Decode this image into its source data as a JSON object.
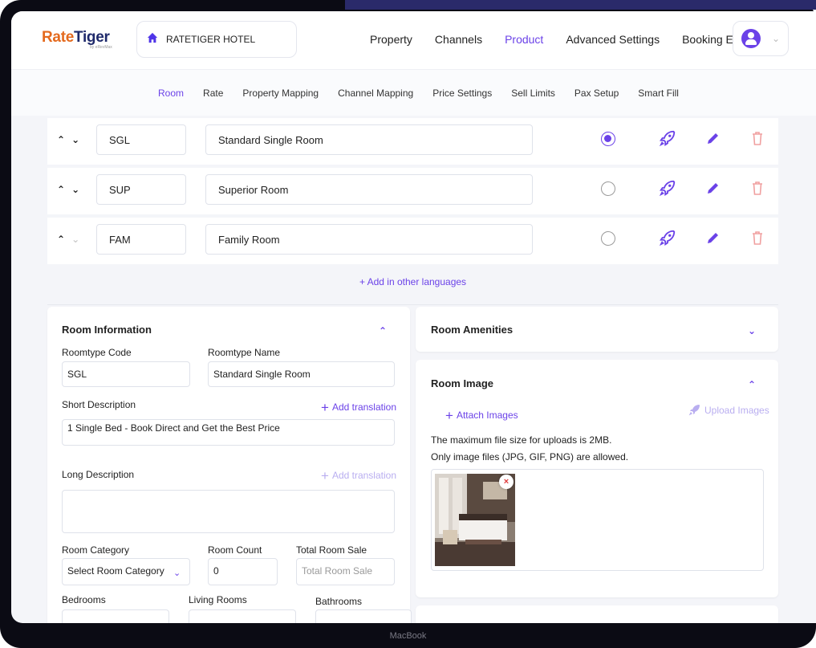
{
  "brand": {
    "name_first": "Rate",
    "name_second": "Tiger",
    "sub": "by eRevMax"
  },
  "hotel_selector": {
    "label": "RATETIGER HOTEL"
  },
  "top_nav": [
    {
      "label": "Property",
      "active": false
    },
    {
      "label": "Channels",
      "active": false
    },
    {
      "label": "Product",
      "active": true
    },
    {
      "label": "Advanced Settings",
      "active": false
    },
    {
      "label": "Booking Engine",
      "active": false
    }
  ],
  "sub_nav": [
    {
      "label": "Room",
      "active": true
    },
    {
      "label": "Rate",
      "active": false
    },
    {
      "label": "Property Mapping",
      "active": false
    },
    {
      "label": "Channel Mapping",
      "active": false
    },
    {
      "label": "Price Settings",
      "active": false
    },
    {
      "label": "Sell Limits",
      "active": false
    },
    {
      "label": "Pax Setup",
      "active": false
    },
    {
      "label": "Smart Fill",
      "active": false
    }
  ],
  "rooms": [
    {
      "code": "SGL",
      "name": "Standard Single Room",
      "default": true
    },
    {
      "code": "SUP",
      "name": "Superior Room",
      "default": false
    },
    {
      "code": "FAM",
      "name": "Family Room",
      "default": false
    }
  ],
  "add_languages": "+ Add in other languages",
  "room_info": {
    "title": "Room Information",
    "roomtype_code_label": "Roomtype Code",
    "roomtype_code_value": "SGL",
    "roomtype_name_label": "Roomtype Name",
    "roomtype_name_value": "Standard Single Room",
    "short_desc_label": "Short Description",
    "short_desc_value": "1 Single Bed - Book Direct and Get the Best Price",
    "add_translation": "Add translation",
    "long_desc_label": "Long Description",
    "long_desc_value": "",
    "room_category_label": "Room Category",
    "room_category_value": "Select Room Category",
    "room_count_label": "Room Count",
    "room_count_value": "0",
    "total_room_sale_label": "Total Room Sale",
    "total_room_sale_placeholder": "Total Room Sale",
    "bedrooms_label": "Bedrooms",
    "living_rooms_label": "Living Rooms",
    "bathrooms_label": "Bathrooms"
  },
  "amenities": {
    "title": "Room Amenities"
  },
  "room_image": {
    "title": "Room Image",
    "attach": "Attach Images",
    "upload": "Upload Images",
    "note1": "The maximum file size for uploads is 2MB.",
    "note2": "Only image files (JPG, GIF, PNG) are allowed."
  },
  "device_label": "MacBook",
  "colors": {
    "accent": "#6b42e8",
    "brand_navy": "#1f2a6b",
    "brand_orange": "#e46a1e",
    "delete": "#f0a0a0"
  }
}
